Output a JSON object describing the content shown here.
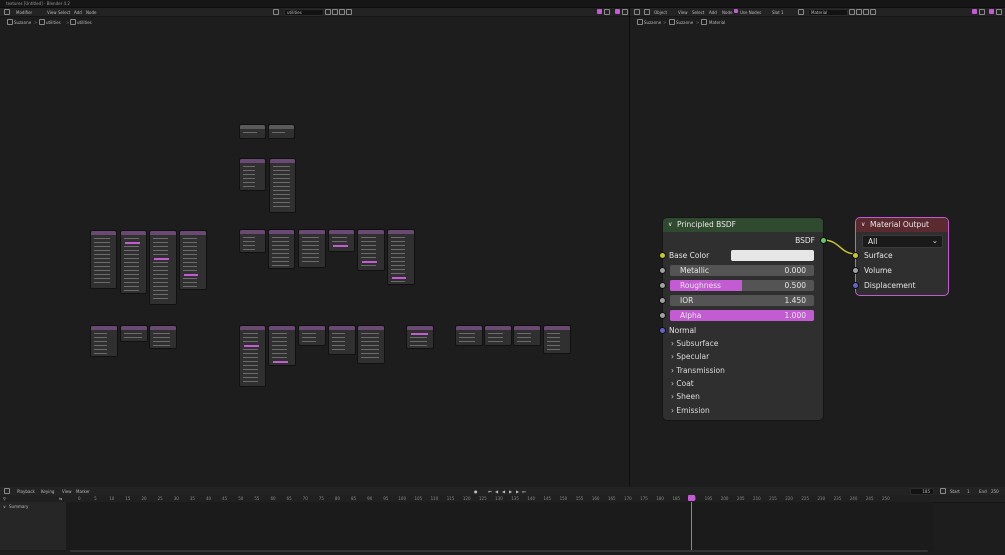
{
  "window": {
    "title": "textures [Untitled] - Blender 4.2"
  },
  "top_left_header": {
    "editor_label": "Modifier",
    "menus": [
      "View",
      "Select",
      "Add",
      "Node"
    ],
    "nodegroup_field": "utilities"
  },
  "top_right_header": {
    "mode_label": "Object",
    "menus": [
      "View",
      "Select",
      "Add",
      "Node"
    ],
    "use_nodes_label": "Use Nodes",
    "slot_label": "Slot 1",
    "material_field": "Material"
  },
  "left_breadcrumb": [
    "Suzanne",
    "utilities",
    "utilities"
  ],
  "right_breadcrumb": [
    "Suzanne",
    "Suzanne",
    "Material"
  ],
  "principled_node": {
    "title": "Principled BSDF",
    "output_label": "BSDF",
    "base_color_label": "Base Color",
    "metallic": {
      "label": "Metallic",
      "value": "0.000",
      "fraction": 0.0
    },
    "roughness": {
      "label": "Roughness",
      "value": "0.500",
      "fraction": 0.5
    },
    "ior": {
      "label": "IOR",
      "value": "1.450",
      "fraction": 0.0
    },
    "alpha": {
      "label": "Alpha",
      "value": "1.000",
      "fraction": 1.0
    },
    "normal_label": "Normal",
    "panels": [
      "Subsurface",
      "Specular",
      "Transmission",
      "Coat",
      "Sheen",
      "Emission"
    ]
  },
  "output_node": {
    "title": "Material Output",
    "target": "All",
    "inputs": [
      "Surface",
      "Volume",
      "Displacement"
    ]
  },
  "timeline": {
    "menus": [
      "Playback",
      "Keying",
      "View",
      "Marker"
    ],
    "current_frame": "185",
    "start_label": "Start",
    "start_value": "1",
    "end_label": "End",
    "end_value": "250",
    "summary_label": "Summary",
    "ticks": [
      "0",
      "5",
      "10",
      "15",
      "20",
      "25",
      "30",
      "35",
      "40",
      "45",
      "50",
      "55",
      "60",
      "65",
      "70",
      "75",
      "80",
      "85",
      "90",
      "95",
      "100",
      "105",
      "110",
      "115",
      "120",
      "125",
      "130",
      "135",
      "140",
      "145",
      "150",
      "155",
      "160",
      "165",
      "170",
      "175",
      "180",
      "185",
      "190",
      "195",
      "200",
      "205",
      "210",
      "215",
      "220",
      "225",
      "230",
      "235",
      "240",
      "245",
      "250"
    ]
  },
  "colors": {
    "accent": "#c35bd3",
    "bsdf_header": "#2f4a2f",
    "output_header": "#5a2a30",
    "socket_yellow": "#c7c729",
    "socket_gray": "#a1a1a1",
    "socket_green": "#63c763",
    "socket_purple": "#6363c7"
  }
}
